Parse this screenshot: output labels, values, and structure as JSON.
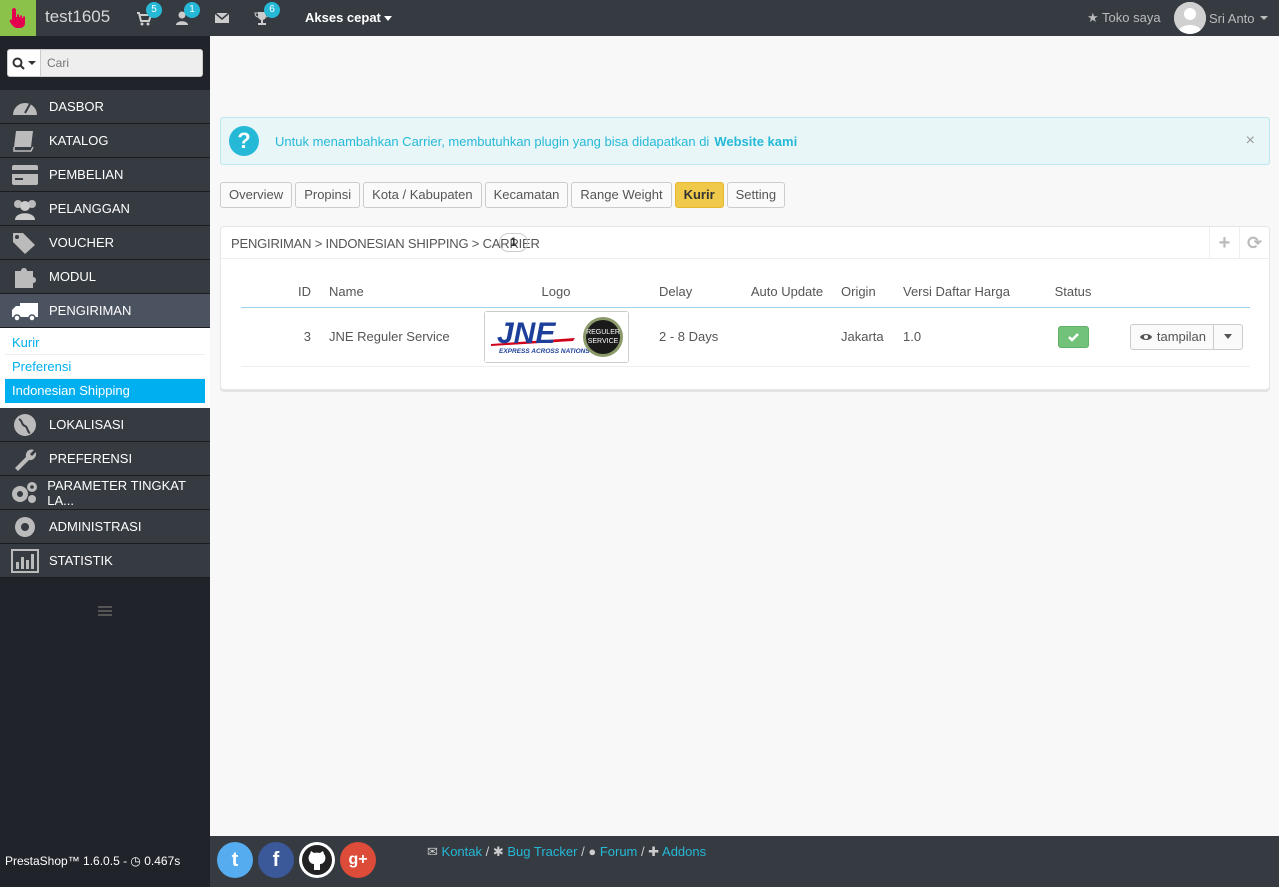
{
  "header": {
    "shop_name": "test1605",
    "notifications": [
      {
        "icon": "cart-icon",
        "count": "5"
      },
      {
        "icon": "user-icon",
        "count": "1"
      },
      {
        "icon": "envelope-icon",
        "count": ""
      },
      {
        "icon": "trophy-icon",
        "count": "6"
      }
    ],
    "quick_access": "Akses cepat",
    "my_shop": "Toko saya",
    "employee": "Sri Anto"
  },
  "search": {
    "placeholder": "Cari"
  },
  "sidebar": {
    "items": [
      {
        "label": "DASBOR",
        "icon": "dashboard-icon"
      },
      {
        "label": "KATALOG",
        "icon": "book-icon"
      },
      {
        "label": "PEMBELIAN",
        "icon": "credit-card-icon"
      },
      {
        "label": "PELANGGAN",
        "icon": "users-icon"
      },
      {
        "label": "VOUCHER",
        "icon": "tags-icon"
      },
      {
        "label": "MODUL",
        "icon": "puzzle-icon"
      },
      {
        "label": "PENGIRIMAN",
        "icon": "truck-icon"
      },
      {
        "label": "LOKALISASI",
        "icon": "globe-icon"
      },
      {
        "label": "PREFERENSI",
        "icon": "wrench-icon"
      },
      {
        "label": "PARAMETER TINGKAT LA...",
        "icon": "cogs-icon"
      },
      {
        "label": "ADMINISTRASI",
        "icon": "cog-icon"
      },
      {
        "label": "STATISTIK",
        "icon": "bar-chart-icon"
      }
    ],
    "submenu": [
      "Kurir",
      "Preferensi",
      "Indonesian Shipping"
    ]
  },
  "alert": {
    "text": "Untuk menambahkan Carrier, membutuhkan plugin yang bisa didapatkan di",
    "link": "Website kami",
    "close": "×"
  },
  "tabs": [
    "Overview",
    "Propinsi",
    "Kota / Kabupaten",
    "Kecamatan",
    "Range Weight",
    "Kurir",
    "Setting"
  ],
  "panel": {
    "title": "PENGIRIMAN > INDONESIAN SHIPPING > CARRIER",
    "count": "1",
    "tool_add": "+",
    "tool_refresh": "⟳"
  },
  "table": {
    "headers": [
      "ID",
      "Name",
      "Logo",
      "Delay",
      "Auto Update",
      "Origin",
      "Versi Daftar Harga",
      "Status"
    ],
    "rows": [
      {
        "id": "3",
        "name": "JNE Reguler Service",
        "delay": "2 - 8 Days",
        "auto_update": "",
        "origin": "Jakarta",
        "versi": "1.0",
        "action": "tampilan"
      }
    ],
    "logo": {
      "brand": "JNE",
      "tagline": "EXPRESS ACROSS NATIONS",
      "seal_line1": "REGULER",
      "seal_line2": "SERVICE"
    }
  },
  "footer": {
    "version": "PrestaShop™ 1.6.0.5 - ",
    "load_time": "0.467s",
    "social_twitter": "t",
    "social_facebook": "f",
    "social_github": "",
    "social_google": "g+",
    "links": [
      "Kontak",
      "Bug Tracker",
      "Forum",
      "Addons"
    ]
  },
  "colors": {
    "accent": "#25b9d7",
    "active_tab": "#f0c84a",
    "status_ok": "#72c279",
    "sidebar_bg": "#202329",
    "topbar_bg": "#363a41"
  }
}
